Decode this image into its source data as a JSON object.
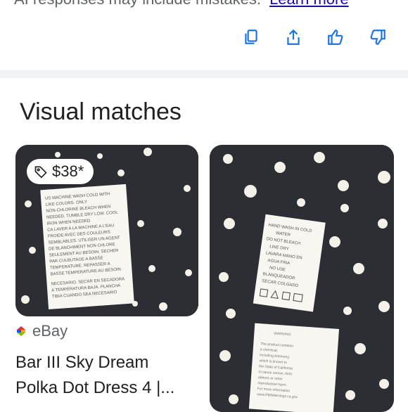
{
  "ai_notice": {
    "text": "AI responses may include mistakes.",
    "link": "Learn more"
  },
  "actions": [
    {
      "name": "copy",
      "icon": "copy-icon"
    },
    {
      "name": "share",
      "icon": "share-icon"
    },
    {
      "name": "thumbs-up",
      "icon": "thumbs-up-icon"
    },
    {
      "name": "thumbs-down",
      "icon": "thumbs-down-icon"
    }
  ],
  "visual_matches": {
    "heading": "Visual matches",
    "items": [
      {
        "price": "$38*",
        "source": "eBay",
        "title_line1": "Bar III Sky Dream",
        "title_line2": "Polka Dot Dress 4 |...",
        "image_text": "US MACHINE WASH COLD WITH LIKE COLORS. ONLY NON-CHLORINE BLEACH WHEN NEEDED. TUMBLE DRY LOW. COOL IRON WHEN NEEDED"
      },
      {
        "image_text": "HAND WASH IN COLD WATER DO NOT BLEACH LINE DRY"
      }
    ]
  },
  "colors": {
    "accent": "#1a73e8",
    "fabric": "#2c2e34",
    "dot": "#f4f1e8",
    "label": "#f7f6f1"
  }
}
